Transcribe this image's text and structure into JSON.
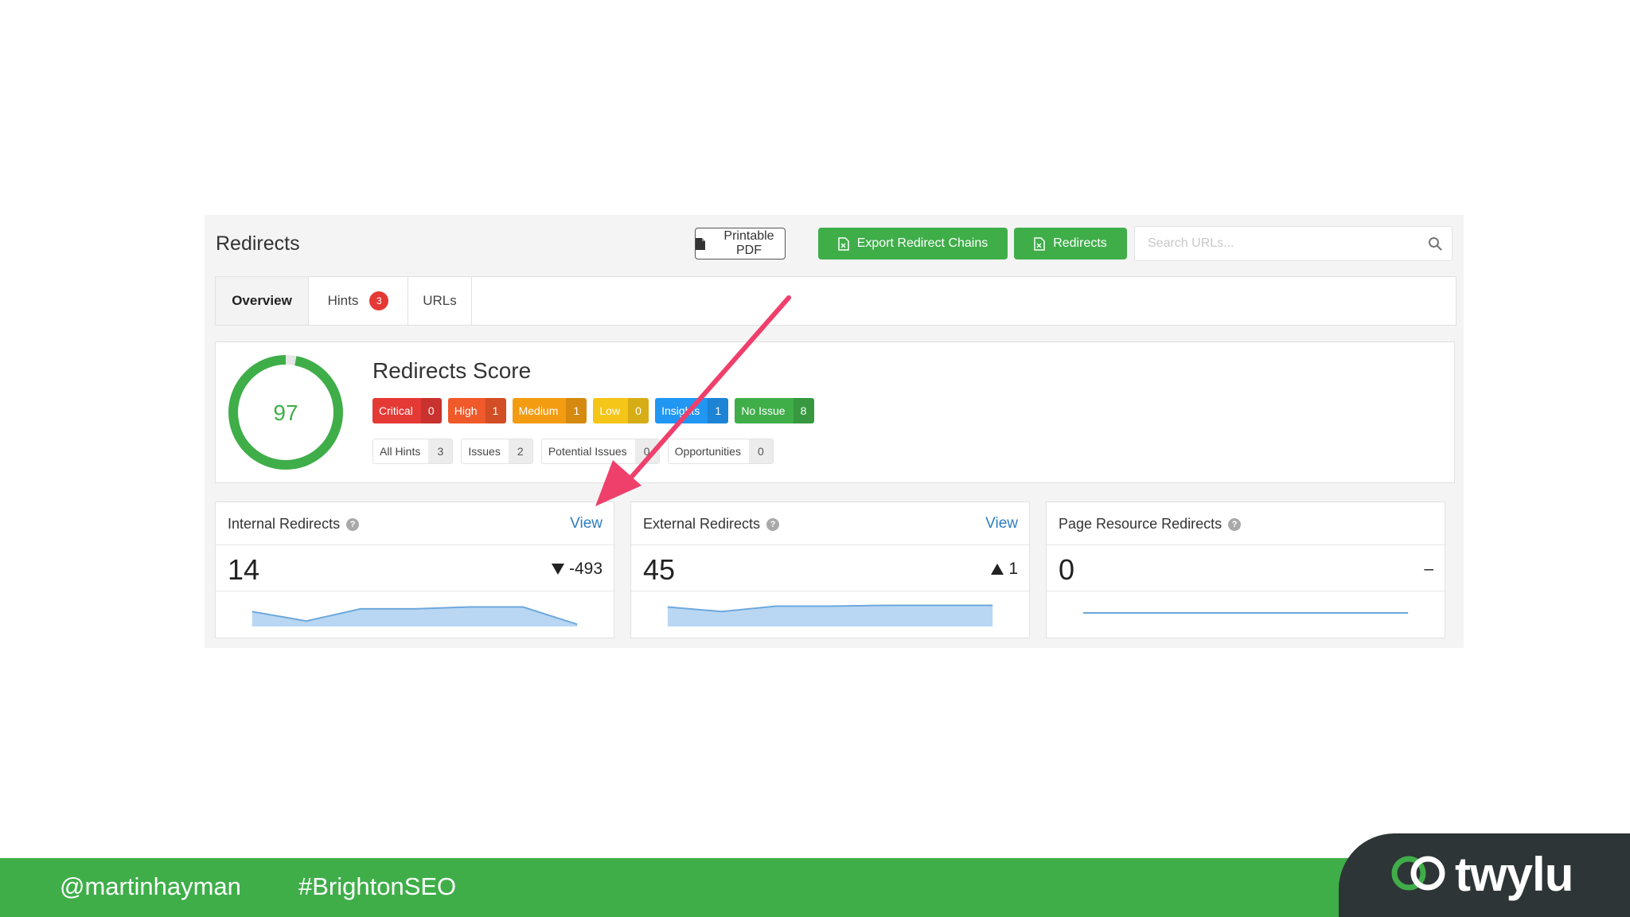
{
  "header": {
    "title": "Redirects",
    "printable_pdf_label": "Printable PDF",
    "export_chains_label": "Export Redirect Chains",
    "redirects_button_label": "Redirects",
    "search_placeholder": "Search URLs..."
  },
  "tabs": [
    {
      "label": "Overview",
      "active": true
    },
    {
      "label": "Hints",
      "badge": "3"
    },
    {
      "label": "URLs"
    }
  ],
  "score": {
    "title": "Redirects Score",
    "value": "97",
    "fill_fraction": 0.97,
    "ring_color": "#3fae49",
    "severities": [
      {
        "label": "Critical",
        "count": "0",
        "color": "#e53935"
      },
      {
        "label": "High",
        "count": "1",
        "color": "#f0592a"
      },
      {
        "label": "Medium",
        "count": "1",
        "color": "#f39c12"
      },
      {
        "label": "Low",
        "count": "0",
        "color": "#f5c518"
      },
      {
        "label": "Insights",
        "count": "1",
        "color": "#2196f3"
      },
      {
        "label": "No Issue",
        "count": "8",
        "color": "#3fae49"
      }
    ],
    "hint_filters": [
      {
        "label": "All Hints",
        "count": "3"
      },
      {
        "label": "Issues",
        "count": "2"
      },
      {
        "label": "Potential Issues",
        "count": "0"
      },
      {
        "label": "Opportunities",
        "count": "0"
      }
    ]
  },
  "metrics": [
    {
      "title": "Internal Redirects",
      "view": "View",
      "value": "14",
      "delta": "-493",
      "direction": "down",
      "trend": [
        0.55,
        0.2,
        0.65,
        0.65,
        0.72,
        0.72,
        0.08
      ]
    },
    {
      "title": "External Redirects",
      "view": "View",
      "value": "45",
      "delta": "1",
      "direction": "up",
      "trend": [
        0.72,
        0.55,
        0.75,
        0.75,
        0.78,
        0.78,
        0.78
      ]
    },
    {
      "title": "Page Resource Redirects",
      "view": "",
      "value": "0",
      "delta": "–",
      "direction": "none",
      "trend": [
        0.5,
        0.5,
        0.5,
        0.5,
        0.5,
        0.5,
        0.5
      ]
    }
  ],
  "footer": {
    "handle": "@martinhayman",
    "hashtag": "#BrightonSEO",
    "logo": "twylu",
    "banner_color": "#3fae49"
  },
  "annotation": {
    "arrow_color": "#ef3f6b"
  }
}
